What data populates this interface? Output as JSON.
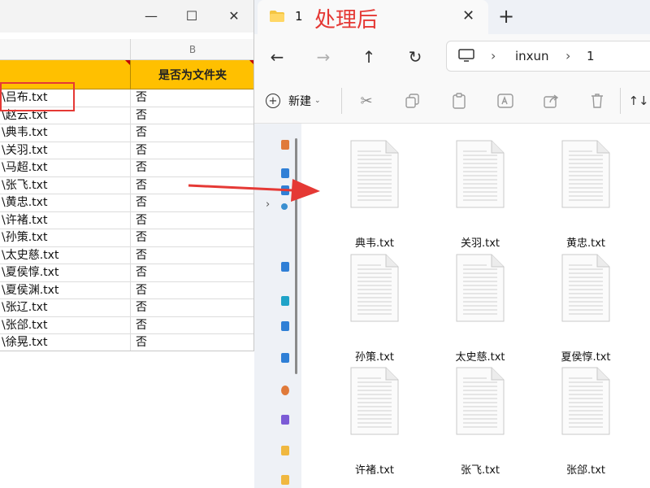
{
  "excel": {
    "window_buttons": {
      "minimize": "—",
      "maximize": "☐",
      "close": "✕"
    },
    "column_letter": "B",
    "header_b": "是否为文件夹",
    "rows": [
      {
        "a": "\\吕布.txt",
        "b": "否"
      },
      {
        "a": "\\赵云.txt",
        "b": "否"
      },
      {
        "a": "\\典韦.txt",
        "b": "否"
      },
      {
        "a": "\\关羽.txt",
        "b": "否"
      },
      {
        "a": "\\马超.txt",
        "b": "否"
      },
      {
        "a": "\\张飞.txt",
        "b": "否"
      },
      {
        "a": "\\黄忠.txt",
        "b": "否"
      },
      {
        "a": "\\许褚.txt",
        "b": "否"
      },
      {
        "a": "\\孙策.txt",
        "b": "否"
      },
      {
        "a": "\\太史慈.txt",
        "b": "否"
      },
      {
        "a": "\\夏侯惇.txt",
        "b": "否"
      },
      {
        "a": "\\夏侯渊.txt",
        "b": "否"
      },
      {
        "a": "\\张辽.txt",
        "b": "否"
      },
      {
        "a": "\\张郃.txt",
        "b": "否"
      },
      {
        "a": "\\徐晃.txt",
        "b": "否"
      }
    ],
    "highlight_color": "#e53935",
    "header_color": "#ffc000"
  },
  "overlay_title": "处理后",
  "explorer": {
    "tab_label": "1",
    "tab_close": "✕",
    "new_tab": "+",
    "nav": {
      "back": "←",
      "forward": "→",
      "up": "↑",
      "refresh": "↻"
    },
    "breadcrumb": [
      "inxun",
      "1"
    ],
    "breadcrumb_sep": "›",
    "new_label": "新建",
    "new_chevron": "⌄",
    "sort_label": "↑↓",
    "files": [
      "典韦.txt",
      "关羽.txt",
      "黄忠.txt",
      "孙策.txt",
      "太史慈.txt",
      "夏侯惇.txt",
      "许褚.txt",
      "张飞.txt",
      "张郃.txt"
    ]
  }
}
